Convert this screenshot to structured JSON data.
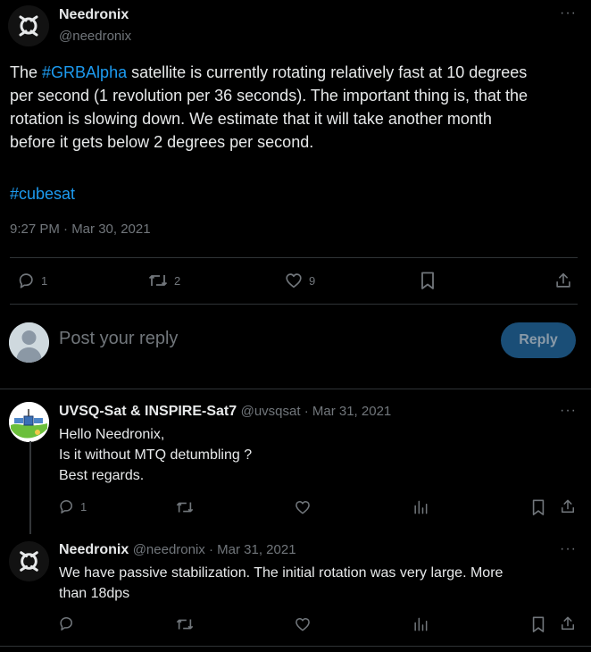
{
  "main_tweet": {
    "author_name": "Needronix",
    "author_handle": "@needronix",
    "text_lines": [
      [
        "The ",
        "#GRBAlpha",
        " satellite is currently rotating relatively fast at 10 degrees"
      ],
      "per second (1 revolution per 36 seconds). The important thing is, that the",
      "rotation is slowing down. We estimate that it will take another month",
      "before it gets below 2 degrees per second."
    ],
    "hashtag": "#cubesat",
    "timestamp": "9:27 PM · Mar 30, 2021",
    "more": "···",
    "actions": {
      "replies": "1",
      "reposts": "2",
      "likes": "9"
    }
  },
  "reply_composer": {
    "placeholder": "Post your reply",
    "button_label": "Reply"
  },
  "replies": [
    {
      "author_name": "UVSQ-Sat & INSPIRE-Sat7",
      "meta": "@uvsqsat · Mar 31, 2021",
      "lines": [
        "Hello Needronix,",
        "Is it without MTQ detumbling ?",
        "Best regards."
      ],
      "reply_count": "1",
      "more": "···"
    },
    {
      "author_name": "Needronix",
      "meta": "@needronix · Mar 31, 2021",
      "lines": [
        "We have passive stabilization.  The initial rotation was very large.  More",
        "than 18dps"
      ],
      "reply_count": "",
      "more": "···"
    }
  ],
  "colors": {
    "background": "#000000",
    "text": "#e7e9ea",
    "muted": "#71767b",
    "link": "#1d9bf0",
    "divider": "#2f3336",
    "reply_button": "#1a4e77"
  }
}
